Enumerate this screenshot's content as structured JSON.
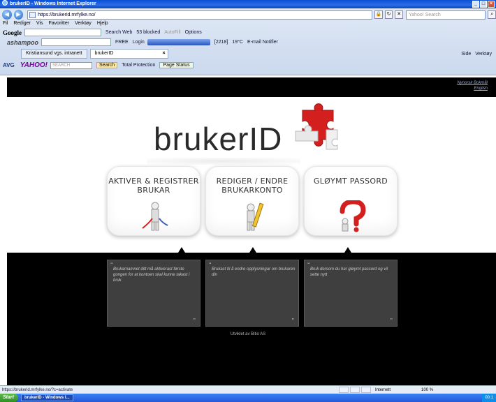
{
  "window": {
    "title": "brukerID - Windows Internet Explorer",
    "controls": [
      "_",
      "□",
      "×"
    ]
  },
  "address": {
    "url": "https://brukerid.mrfylke.no/",
    "search_placeholder": "Yahoo! Search"
  },
  "menubar": [
    "Fil",
    "Rediger",
    "Vis",
    "Favoritter",
    "Verktøy",
    "Hjelp"
  ],
  "google_toolbar": {
    "logo": "Google",
    "search_web": "Search Web",
    "blocked": "53 blocked",
    "autofill": "AutoFill",
    "options": "Options"
  },
  "toolbar2": {
    "ashampoo": "ashampoo",
    "free": "FREE",
    "login": "Login",
    "counter": "[2218]",
    "temp": "19°C",
    "email": "E-mail Notifier"
  },
  "tabs": [
    {
      "label": "Kristiansund vgs. intranett"
    },
    {
      "label": "brukerID"
    }
  ],
  "ie_cmds": {
    "side": "Side",
    "verktoy": "Verktøy"
  },
  "avg": {
    "label": "AVG",
    "yahoo": "YAHOO!",
    "search_box": "SEARCH",
    "search_btn": "Search",
    "total": "Total Protection",
    "page_status": "Page Status"
  },
  "page": {
    "lang": [
      "Nynorsk Bokmål",
      "English"
    ],
    "logo": "brukerID",
    "cards": [
      {
        "title": "AKTIVER & REGISTRER BRUKAR",
        "desc": "Brukarnamnet ditt må aktiverast første gongen for at kontoen skal kunne takast i bruk"
      },
      {
        "title": "REDIGER / ENDRE BRUKARKONTO",
        "desc": "Brukast til å endre opplysningar om brukaren din"
      },
      {
        "title": "GLØYMT PASSORD",
        "desc": "Bruk dersom du har gløymt passord og vil sette nytt"
      }
    ],
    "quote_open": "“",
    "quote_close": "”",
    "footer": "Utviklet av Bitio AS"
  },
  "status": {
    "url": "https://brukerid.mrfylke.no/?c=activate",
    "zone": "Internett",
    "zoom": "100 %"
  },
  "taskbar": {
    "start": "Start",
    "task": "brukerID - Windows I...",
    "clock": "00:1"
  },
  "colors": {
    "puzzle_red": "#d41f1f",
    "band_black": "#000000",
    "info_bg": "#3f3f3f"
  }
}
